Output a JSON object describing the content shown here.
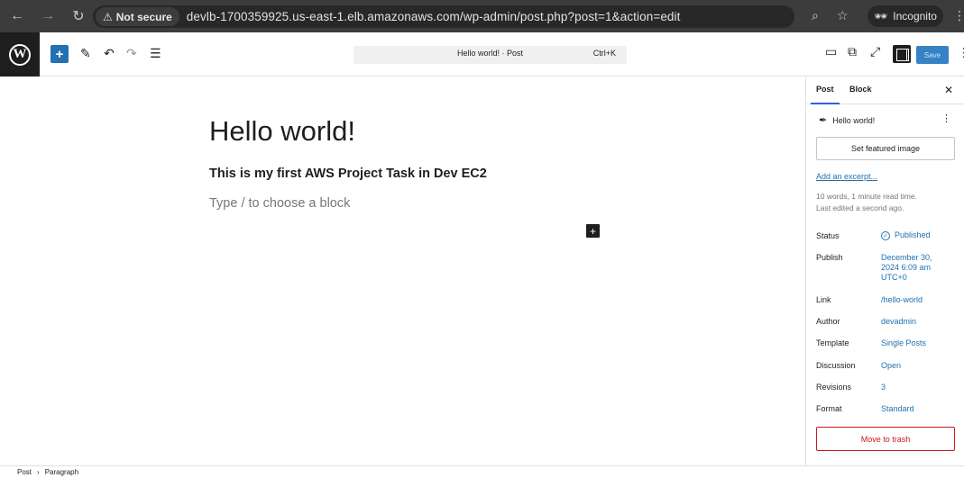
{
  "browser": {
    "back_icon": "back-arrow-icon",
    "forward_icon": "forward-arrow-icon",
    "reload_icon": "reload-icon",
    "security_label": "Not secure",
    "url": "devlb-1700359925.us-east-1.elb.amazonaws.com/wp-admin/post.php?post=1&action=edit",
    "incognito_label": "Incognito"
  },
  "toolbar": {
    "document_title": "Hello world! · Post",
    "shortcut": "Ctrl+K",
    "save_label": "Save"
  },
  "editor": {
    "title": "Hello world!",
    "paragraph": "This is my first AWS Project Task in Dev EC2",
    "placeholder": "Type / to choose a block"
  },
  "sidebar": {
    "tabs": [
      "Post",
      "Block"
    ],
    "post_title": "Hello world!",
    "featured_image_label": "Set featured image",
    "excerpt_link": "Add an excerpt...",
    "meta_line1": "10 words, 1 minute read time.",
    "meta_line2": "Last edited a second ago.",
    "rows": [
      {
        "label": "Status",
        "value": "Published"
      },
      {
        "label": "Publish",
        "value_lines": [
          "December 30,",
          "2024 6:09 am",
          "UTC+0"
        ]
      },
      {
        "label": "Link",
        "value": "/hello-world"
      },
      {
        "label": "Author",
        "value": "devadmin"
      },
      {
        "label": "Template",
        "value": "Single Posts"
      },
      {
        "label": "Discussion",
        "value": "Open"
      },
      {
        "label": "Revisions",
        "value": "3"
      },
      {
        "label": "Format",
        "value": "Standard"
      }
    ],
    "trash_label": "Move to trash"
  },
  "footer": {
    "breadcrumb": [
      "Post",
      "Paragraph"
    ]
  },
  "colors": {
    "accent": "#2271b1",
    "danger": "#cc1818",
    "chrome_bg": "#3c3c3c"
  }
}
